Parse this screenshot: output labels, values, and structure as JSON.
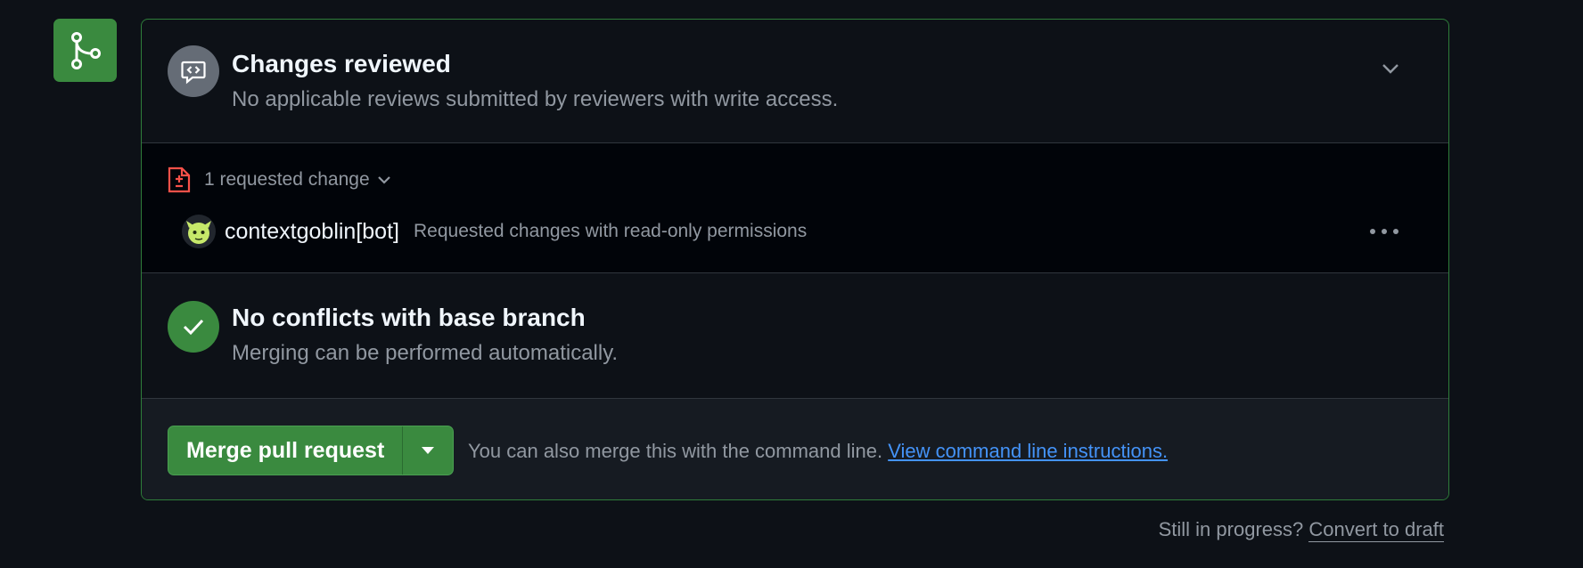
{
  "review": {
    "title": "Changes reviewed",
    "subtitle": "No applicable reviews submitted by reviewers with write access."
  },
  "requested": {
    "label": "1 requested change",
    "reviewer": {
      "name": "contextgoblin[bot]",
      "note": "Requested changes with read-only permissions"
    }
  },
  "conflicts": {
    "title": "No conflicts with base branch",
    "subtitle": "Merging can be performed automatically."
  },
  "merge": {
    "button_label": "Merge pull request",
    "hint": "You can also merge this with the command line. ",
    "link": "View command line instructions."
  },
  "draft": {
    "prompt": "Still in progress? ",
    "link": "Convert to draft"
  },
  "colors": {
    "success": "#3a8a3f",
    "danger": "#f85149",
    "link": "#4493f8",
    "muted": "#9198a1"
  }
}
